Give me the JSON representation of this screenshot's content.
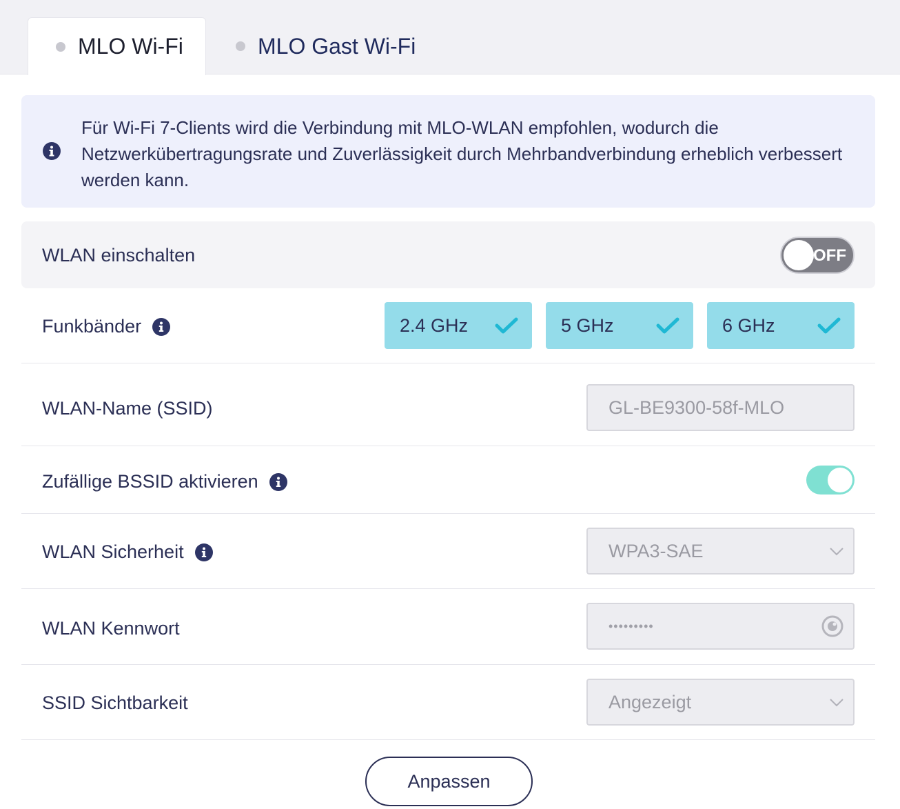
{
  "tabs": [
    {
      "label": "MLO Wi-Fi",
      "active": true
    },
    {
      "label": "MLO Gast Wi-Fi",
      "active": false
    }
  ],
  "info_notice": {
    "text": "Für Wi-Fi 7-Clients wird die Verbindung mit MLO-WLAN empfohlen, wodurch die Netzwerkübertragungsrate und Zuverlässigkeit durch Mehrbandverbindung erheblich verbessert werden kann."
  },
  "wlan_enable": {
    "label": "WLAN einschalten",
    "toggle_label": "OFF",
    "state": "off"
  },
  "bands": {
    "label": "Funkbänder",
    "options": [
      {
        "label": "2.4 GHz",
        "checked": true
      },
      {
        "label": "5 GHz",
        "checked": true
      },
      {
        "label": "6 GHz",
        "checked": true
      }
    ]
  },
  "ssid": {
    "label": "WLAN-Name (SSID)",
    "value": "GL-BE9300-58f-MLO"
  },
  "random_bssid": {
    "label": "Zufällige BSSID aktivieren",
    "state": "on"
  },
  "security": {
    "label": "WLAN Sicherheit",
    "value": "WPA3-SAE"
  },
  "password": {
    "label": "WLAN Kennwort",
    "value": "•••••••••"
  },
  "visibility": {
    "label": "SSID Sichtbarkeit",
    "value": "Angezeigt"
  },
  "apply_button": {
    "label": "Anpassen"
  },
  "colors": {
    "accent_band": "#94dcea",
    "check": "#1fb8d4",
    "toggle_on": "#7fe0d2",
    "info_bg": "#eef0fc",
    "text_primary": "#2b2f55"
  }
}
